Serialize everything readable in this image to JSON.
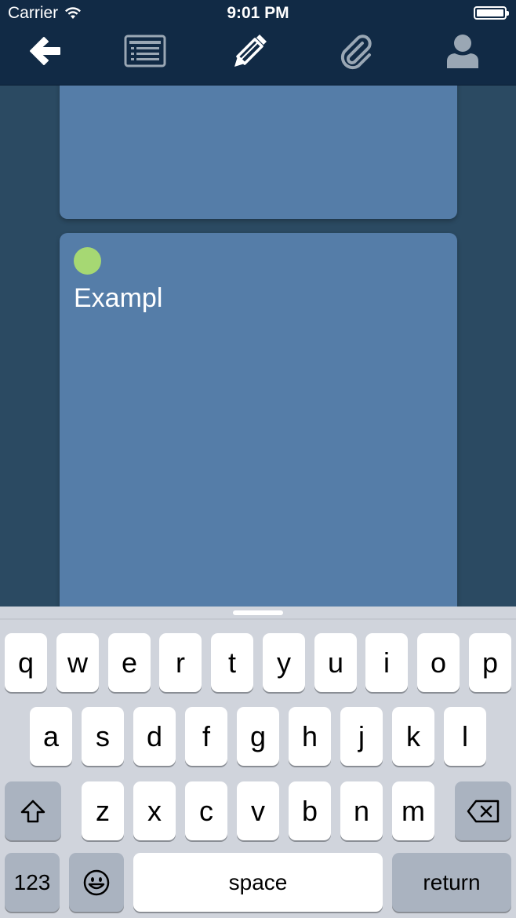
{
  "status_bar": {
    "carrier": "Carrier",
    "time": "9:01 PM"
  },
  "toolbar": {
    "buttons": [
      {
        "icon": "back-arrow-icon"
      },
      {
        "icon": "list-icon"
      },
      {
        "icon": "pencil-icon"
      },
      {
        "icon": "paperclip-icon"
      },
      {
        "icon": "user-icon"
      }
    ]
  },
  "note": {
    "text": "Exampl",
    "dot_color": "#a6d873"
  },
  "keyboard": {
    "row1": [
      "q",
      "w",
      "e",
      "r",
      "t",
      "y",
      "u",
      "i",
      "o",
      "p"
    ],
    "row2": [
      "a",
      "s",
      "d",
      "f",
      "g",
      "h",
      "j",
      "k",
      "l"
    ],
    "row3": [
      "z",
      "x",
      "c",
      "v",
      "b",
      "n",
      "m"
    ],
    "numbers_label": "123",
    "space_label": "space",
    "return_label": "return"
  },
  "colors": {
    "toolbar": "#112a45",
    "background": "#2b4a62",
    "card": "#557da8",
    "keyboard": "#d0d4dc"
  }
}
